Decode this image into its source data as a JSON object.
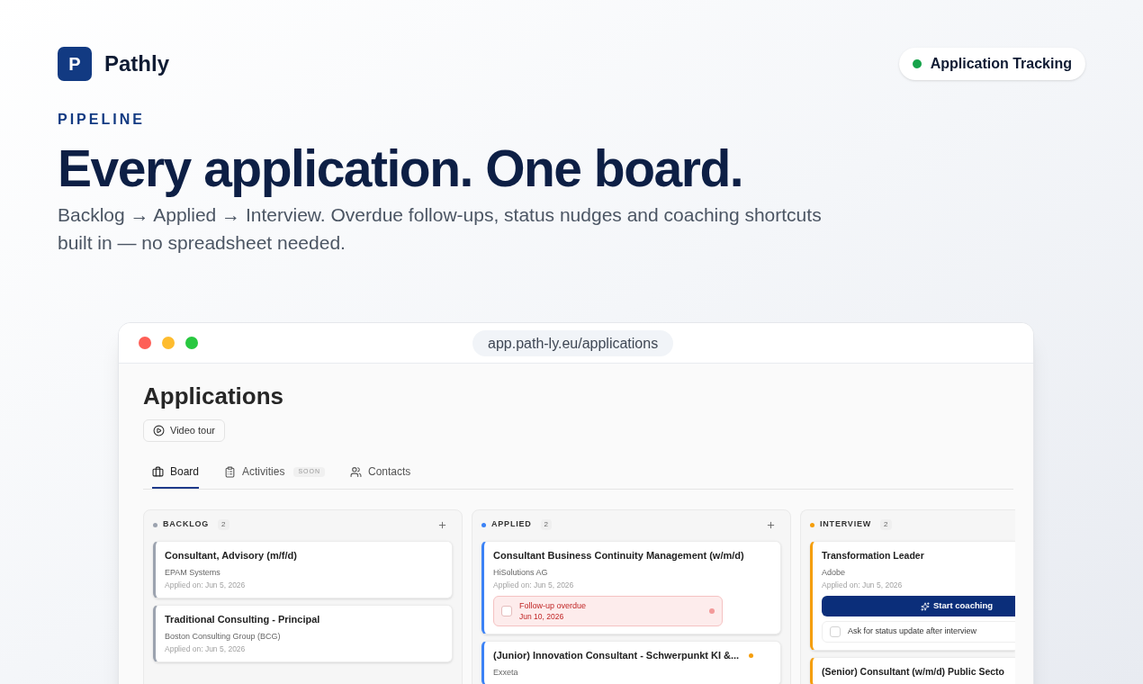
{
  "brand": {
    "logo_letter": "P",
    "name": "Pathly"
  },
  "badge": {
    "label": "Application Tracking",
    "color": "#16a34a"
  },
  "eyebrow": "PIPELINE",
  "headline": "Every application. One board.",
  "subtitle": "Backlog → Applied → Interview. Overdue follow-ups, status nudges and coaching shortcuts built in — no spreadsheet needed.",
  "browser": {
    "url": "app.path-ly.eu/applications"
  },
  "page": {
    "title": "Applications",
    "video_button": "Video tour"
  },
  "tabs": [
    {
      "label": "Board",
      "selected": true
    },
    {
      "label": "Activities",
      "selected": false,
      "badge": "SOON"
    },
    {
      "label": "Contacts",
      "selected": false
    }
  ],
  "columns": [
    {
      "name": "BACKLOG",
      "count": "2",
      "color": "#9ca3af",
      "cards": [
        {
          "title": "Consultant, Advisory (m/f/d)",
          "company": "EPAM Systems",
          "applied": "Applied on: Jun 5, 2026"
        },
        {
          "title": "Traditional Consulting - Principal",
          "company": "Boston Consulting Group (BCG)",
          "applied": "Applied on: Jun 5, 2026"
        }
      ]
    },
    {
      "name": "APPLIED",
      "count": "2",
      "color": "#3b82f6",
      "cards": [
        {
          "title": "Consultant Business Continuity Management (w/m/d)",
          "company": "HiSolutions AG",
          "applied": "Applied on: Jun 5, 2026",
          "follow_up": {
            "label": "Follow-up overdue",
            "date": "Jun 10, 2026",
            "checked": false
          }
        },
        {
          "title": "(Junior) Innovation Consultant - Schwerpunkt KI &...",
          "company": "Exxeta",
          "color": "#f59e0b"
        }
      ]
    },
    {
      "name": "INTERVIEW",
      "count": "2",
      "color": "#f59e0b",
      "cards": [
        {
          "title": "Transformation Leader",
          "company": "Adobe",
          "applied": "Applied on: Jun 5, 2026",
          "action": "Start coaching",
          "task": {
            "label": "Ask for status update after interview",
            "checked": false
          }
        },
        {
          "title": "(Senior) Consultant (w/m/d) Public Secto"
        }
      ]
    }
  ]
}
